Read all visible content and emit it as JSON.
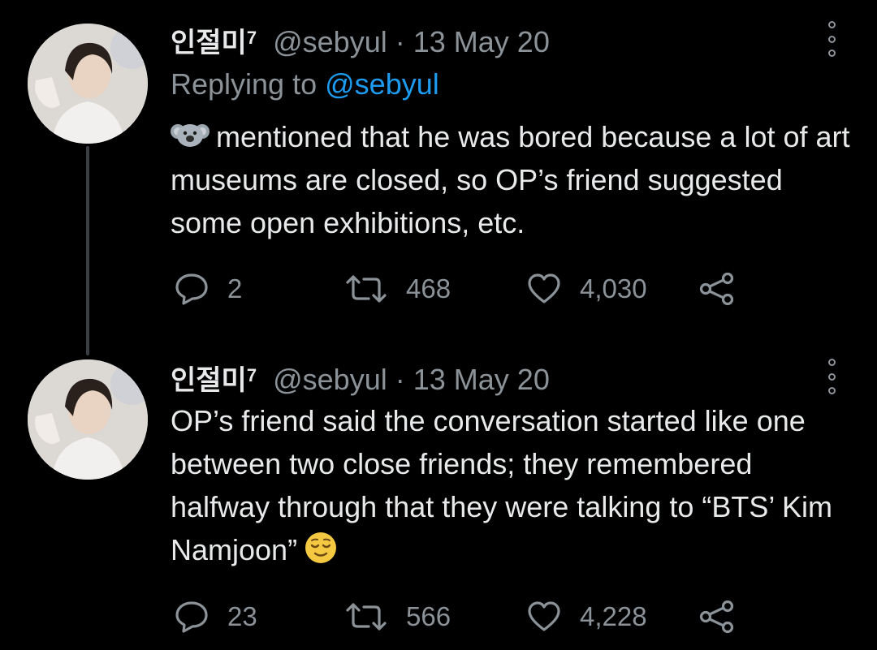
{
  "colors": {
    "background": "#000000",
    "text": "#e7e9ea",
    "secondary": "#8b9298",
    "link": "#1d9bf0",
    "thread_line": "#3a3d41"
  },
  "tweets": [
    {
      "display_name": "인절미",
      "superscript": "7",
      "handle": "@sebyul",
      "separator": "·",
      "date": "13 May 20",
      "replying_prefix": "Replying to",
      "replying_handle": "@sebyul",
      "lead_emoji": "koala-emoji",
      "text": "mentioned that he was bored because a lot of art museums are closed, so OP’s friend suggested some open exhibitions, etc.",
      "stats": {
        "replies": "2",
        "retweets": "468",
        "likes": "4,030"
      }
    },
    {
      "display_name": "인절미",
      "superscript": "7",
      "handle": "@sebyul",
      "separator": "·",
      "date": "13 May 20",
      "text": "OP’s friend said the conversation started like one between two close friends; they remembered halfway through that they were talking to “BTS’ Kim Namjoon”",
      "trail_emoji": "relieved-face-emoji",
      "stats": {
        "replies": "23",
        "retweets": "566",
        "likes": "4,228"
      }
    }
  ]
}
